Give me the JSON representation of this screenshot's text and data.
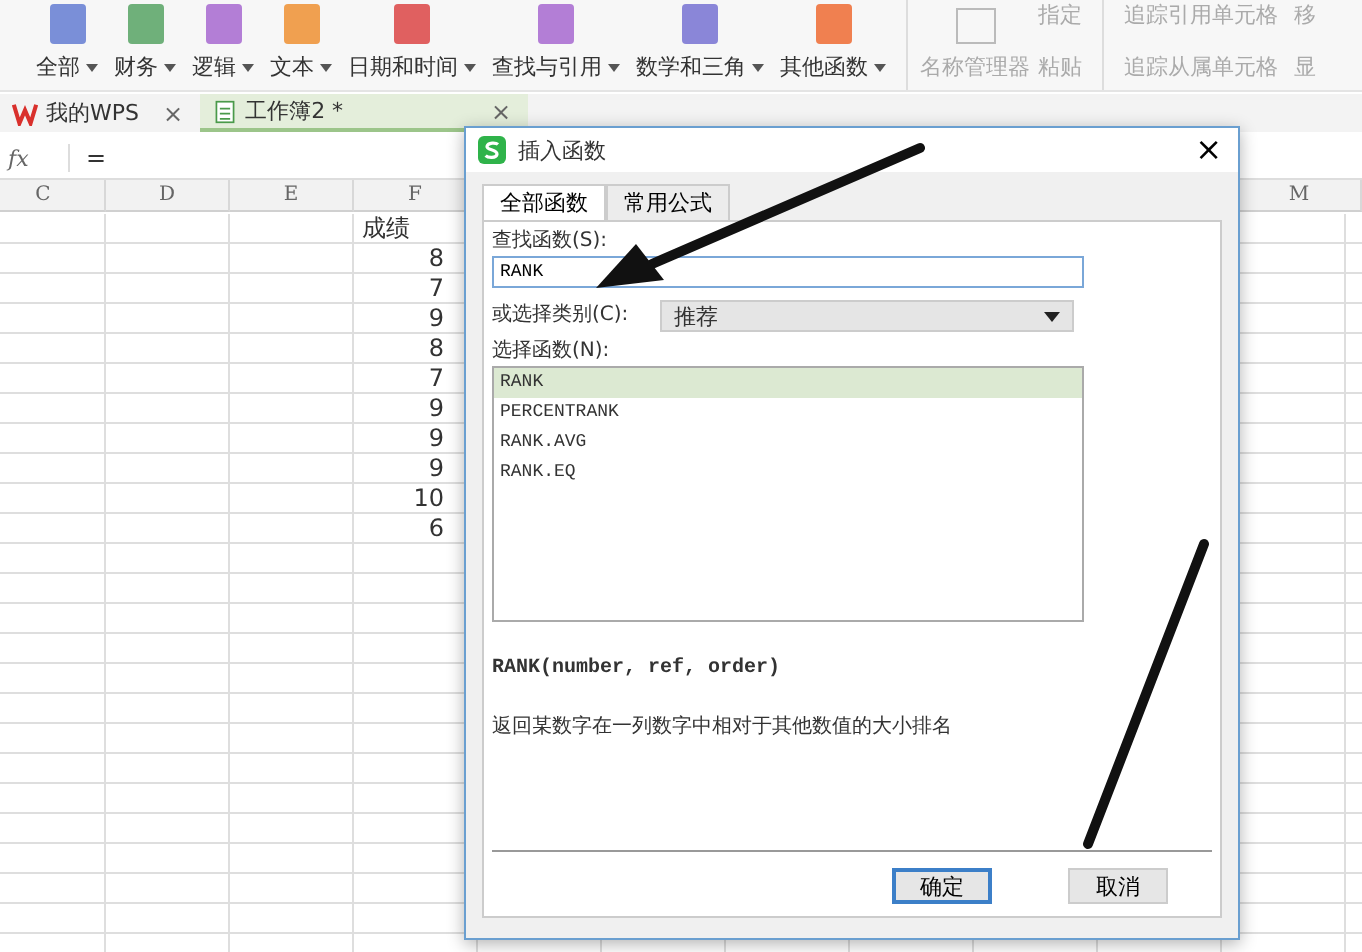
{
  "ribbon": {
    "groups": [
      {
        "label": "全部",
        "color": "#7a8fd8"
      },
      {
        "label": "财务",
        "color": "#6fb07a"
      },
      {
        "label": "逻辑",
        "color": "#b37ed6"
      },
      {
        "label": "文本",
        "color": "#f0a050"
      },
      {
        "label": "日期和时间",
        "color": "#e06060"
      },
      {
        "label": "查找与引用",
        "color": "#b37ed6"
      },
      {
        "label": "数学和三角",
        "color": "#8a86d8"
      },
      {
        "label": "其他函数",
        "color": "#f08050"
      }
    ],
    "name_manager": "名称管理器",
    "define": "指定",
    "paste": "粘贴",
    "trace_precedents": "追踪引用单元格",
    "trace_dependents": "追踪从属单元格",
    "extra_top": "移",
    "extra_bottom": "显"
  },
  "doc_tabs": [
    {
      "label": "我的WPS",
      "kind": "home",
      "selected": false,
      "close": "×"
    },
    {
      "label": "工作簿2 *",
      "kind": "book",
      "selected": true,
      "close": "×"
    }
  ],
  "formula_bar": {
    "fx": "fx",
    "value": "="
  },
  "sheet": {
    "left_columns": [
      "C",
      "D",
      "E",
      "F"
    ],
    "right_columns": [
      "M"
    ],
    "f_column": [
      "成绩",
      "8",
      "7",
      "9",
      "8",
      "7",
      "9",
      "9",
      "9",
      "10",
      "6"
    ]
  },
  "dialog": {
    "title": "插入函数",
    "close": "×",
    "tabs": [
      {
        "label": "全部函数",
        "selected": true
      },
      {
        "label": "常用公式",
        "selected": false
      }
    ],
    "search_label": "查找函数(S):",
    "search_value": "RANK",
    "category_label": "或选择类别(C):",
    "category_value": "推荐",
    "list_label": "选择函数(N):",
    "functions": [
      {
        "name": "RANK",
        "selected": true
      },
      {
        "name": "PERCENTRANK",
        "selected": false
      },
      {
        "name": "RANK.AVG",
        "selected": false
      },
      {
        "name": "RANK.EQ",
        "selected": false
      }
    ],
    "signature": "RANK(number, ref, order)",
    "description": "返回某数字在一列数字中相对于其他数值的大小排名",
    "buttons": [
      "确定",
      "取消"
    ]
  }
}
